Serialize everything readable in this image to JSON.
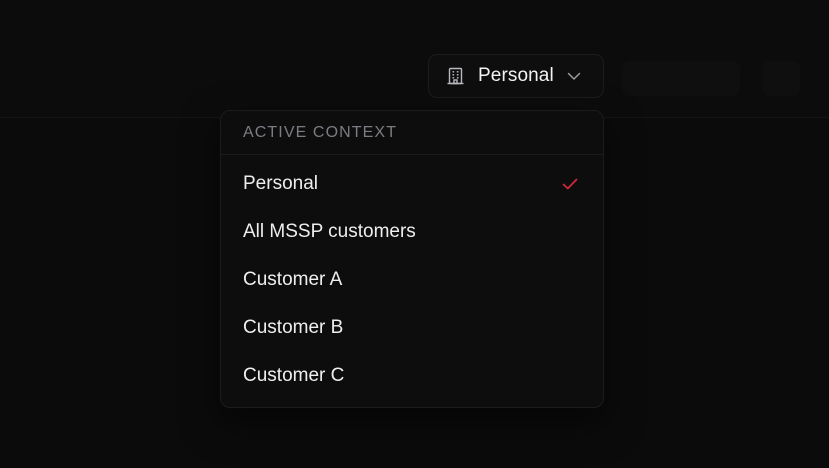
{
  "header": {
    "context_button": {
      "label": "Personal",
      "icon": "building-icon",
      "dropdown_icon": "chevron-down-icon"
    }
  },
  "context_menu": {
    "heading": "ACTIVE CONTEXT",
    "items": [
      {
        "label": "Personal",
        "selected": true
      },
      {
        "label": "All MSSP customers",
        "selected": false
      },
      {
        "label": "Customer A",
        "selected": false
      },
      {
        "label": "Customer B",
        "selected": false
      },
      {
        "label": "Customer C",
        "selected": false
      }
    ],
    "selected_icon": "check-icon"
  },
  "colors": {
    "background": "#0b0b0c",
    "text": "#eeeef0",
    "muted_text": "#7c7c82",
    "accent": "#d6283c",
    "border": "#1c1c1f"
  }
}
